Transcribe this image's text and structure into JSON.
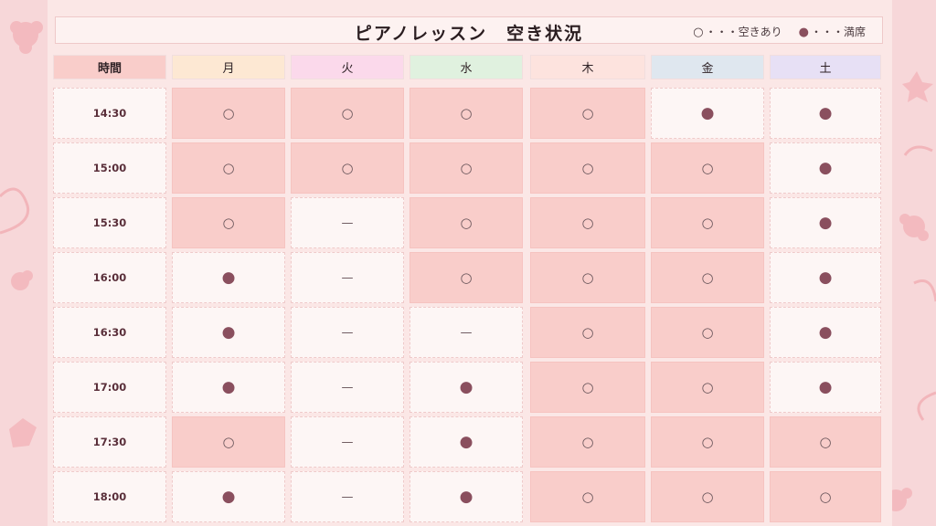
{
  "title": "ピアノレッスン　空き状況",
  "legend": {
    "available_symbol": "○",
    "available_text": "・・・空きあり",
    "full_symbol": "●",
    "full_text": "・・・満席"
  },
  "headers": {
    "time": "時間",
    "days": [
      "月",
      "火",
      "水",
      "木",
      "金",
      "土"
    ],
    "day_colors": [
      "#fde8d3",
      "#fbd9eb",
      "#e0f1df",
      "#fde3de",
      "#dfe7ef",
      "#e7e0f5"
    ],
    "time_color": "#f9cdca"
  },
  "rows": [
    {
      "time": "14:30",
      "cells": [
        "○",
        "○",
        "○",
        "○",
        "●",
        "●"
      ]
    },
    {
      "time": "15:00",
      "cells": [
        "○",
        "○",
        "○",
        "○",
        "○",
        "●"
      ]
    },
    {
      "time": "15:30",
      "cells": [
        "○",
        "—",
        "○",
        "○",
        "○",
        "●"
      ]
    },
    {
      "time": "16:00",
      "cells": [
        "●",
        "—",
        "○",
        "○",
        "○",
        "●"
      ]
    },
    {
      "time": "16:30",
      "cells": [
        "●",
        "—",
        "—",
        "○",
        "○",
        "●"
      ]
    },
    {
      "time": "17:00",
      "cells": [
        "●",
        "—",
        "●",
        "○",
        "○",
        "●"
      ]
    },
    {
      "time": "17:30",
      "cells": [
        "○",
        "—",
        "●",
        "○",
        "○",
        "○"
      ]
    },
    {
      "time": "18:00",
      "cells": [
        "●",
        "—",
        "●",
        "○",
        "○",
        "○"
      ]
    }
  ],
  "colors": {
    "available_fill": "#f9cdca",
    "white_fill": "#fdf6f5",
    "full_dot": "#8a4f5e"
  }
}
